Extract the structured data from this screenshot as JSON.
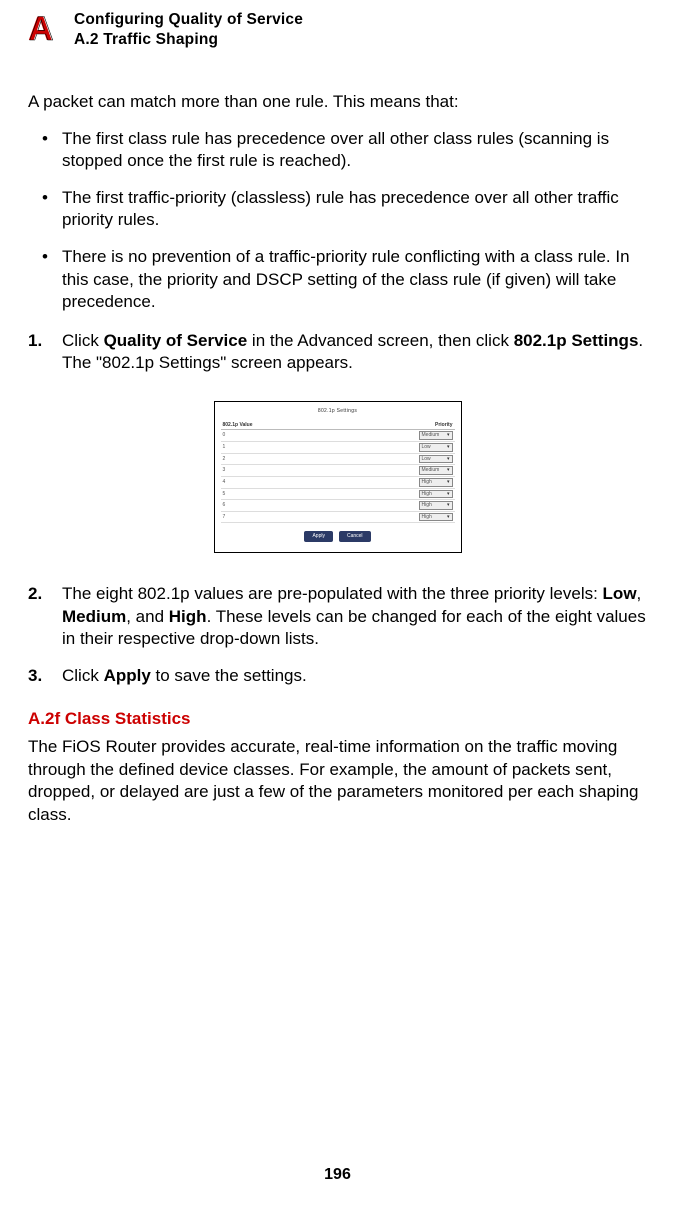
{
  "header": {
    "title": "Configuring Quality of Service",
    "section": "A.2  Traffic Shaping"
  },
  "intro": "A packet can match more than one rule. This means that:",
  "bullets": [
    "The first class rule has precedence over all other class rules (scanning is stopped once the first rule is reached).",
    "The first traffic-priority (classless) rule has precedence over all other traffic priority rules.",
    "There is no prevention of a traffic-priority rule conflicting with a class rule. In this case, the priority and DSCP setting of the class rule (if given) will take precedence."
  ],
  "steps": [
    {
      "num": "1.",
      "pre": "Click ",
      "b1": "Quality of Service",
      "mid": " in the Advanced screen, then click ",
      "b2": "802.1p Settings",
      "post": ". The \"802.1p Settings\" screen appears."
    },
    {
      "num": "2.",
      "pre": "The eight 802.1p values are pre-populated with the three priority levels: ",
      "b1": "Low",
      "mid": ", ",
      "b2": "Medium",
      "mid2": ", and ",
      "b3": "High",
      "post": ". These levels can be changed for each of the eight values in their respective drop-down lists."
    },
    {
      "num": "3.",
      "pre": "Click ",
      "b1": "Apply",
      "post": " to save the settings."
    }
  ],
  "subsection": {
    "heading": "A.2f  Class Statistics",
    "body": "The FiOS Router provides accurate, real-time information on the traffic moving through the defined device classes. For example, the amount of packets sent, dropped, or delayed are just a few of the parameters monitored per each shaping class."
  },
  "screenshot": {
    "title": "802.1p Settings",
    "col1": "802.1p Value",
    "col2": "Priority",
    "rows": [
      {
        "v": "0",
        "p": "Medium"
      },
      {
        "v": "1",
        "p": "Low"
      },
      {
        "v": "2",
        "p": "Low"
      },
      {
        "v": "3",
        "p": "Medium"
      },
      {
        "v": "4",
        "p": "High"
      },
      {
        "v": "5",
        "p": "High"
      },
      {
        "v": "6",
        "p": "High"
      },
      {
        "v": "7",
        "p": "High"
      }
    ],
    "btn_apply": "Apply",
    "btn_cancel": "Cancel"
  },
  "page_number": "196"
}
